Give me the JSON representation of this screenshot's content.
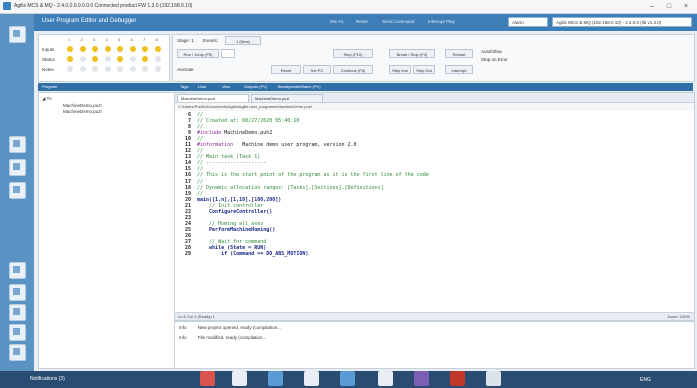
{
  "window": {
    "title": "Agilis MCS & MQ - 2.4.0.0.0.0.0.0.0 Connected product FW 1.3.0 (192.168.0.10)",
    "controls": [
      "–",
      "□",
      "×"
    ]
  },
  "header": {
    "title": "User Program Editor and Debugger",
    "menu": [
      "MS-A1",
      "Reset",
      "Send Command",
      "Interrupt Play"
    ],
    "dropdown_left": "Alarm",
    "dropdown_right": "Agilis MCS & MQ (192.168.0.10) - 2.4.0.0 (lib v1.3.0)"
  },
  "io_panel": {
    "labels": [
      "Inputs",
      "Status",
      "Notes"
    ],
    "columns": [
      "1",
      "2",
      "3",
      "4",
      "5",
      "6",
      "7",
      "8"
    ]
  },
  "controls": {
    "stage_label": "Stage: 1",
    "event_label": "Events:",
    "event_value": "1 (New)",
    "buttons": [
      "Run / Jump (F5)",
      "Step (F10)",
      "Break / Stop (F4)",
      "Reset",
      "Set PC",
      "Continue (F5)",
      "Step Into",
      "Step Out",
      "Restart",
      "Interrupt"
    ],
    "checkbox_1": "Animate",
    "checkbox_2": "Autofollow",
    "checkbox_3": "Stop on Error"
  },
  "tabstrip": [
    "Program",
    "Tags",
    "Lists",
    "Vars",
    "Outputs (PV)",
    "Breakpoints/Watch (PV)"
  ],
  "tree": {
    "root": "◢ Tv",
    "items": [
      "MachineDemo.puzl",
      "MachineDemo.puzl"
    ]
  },
  "editor": {
    "tabs": [
      "MachineDemo.puzl",
      "MachineDemo.puzl"
    ],
    "path": "C:\\Users\\Public\\Documents\\Agilis\\Agilis.user_programs\\MachineDemo.puzl",
    "lines": [
      {
        "n": "6",
        "parts": [
          {
            "c": "cm",
            "t": "//"
          }
        ]
      },
      {
        "n": "7",
        "parts": [
          {
            "c": "cm",
            "t": "// Created at: 08/27/2020 05:40:10"
          }
        ]
      },
      {
        "n": "8",
        "parts": [
          {
            "c": "cm",
            "t": "//"
          }
        ]
      },
      {
        "n": "9",
        "parts": [
          {
            "c": "kw",
            "t": "#include "
          },
          {
            "c": "tx",
            "t": "MachineDemo.puh2"
          }
        ]
      },
      {
        "n": "10",
        "parts": [
          {
            "c": "cm",
            "t": "//"
          }
        ]
      },
      {
        "n": "11",
        "parts": [
          {
            "c": "kw",
            "t": "#information"
          },
          {
            "c": "tx",
            "t": "   Machine demo user program, version 2.0"
          }
        ]
      },
      {
        "n": "12",
        "parts": [
          {
            "c": "cm",
            "t": "//"
          }
        ]
      },
      {
        "n": "13",
        "parts": [
          {
            "c": "cm",
            "t": "// Main task (Task 1)"
          }
        ]
      },
      {
        "n": "14",
        "parts": [
          {
            "c": "cm",
            "t": "// --------------------"
          }
        ]
      },
      {
        "n": "15",
        "parts": [
          {
            "c": "cm",
            "t": "//"
          }
        ]
      },
      {
        "n": "16",
        "parts": [
          {
            "c": "cm",
            "t": "// This is the start point of the program as it is the first line of the code"
          }
        ]
      },
      {
        "n": "17",
        "parts": [
          {
            "c": "cm",
            "t": "//"
          }
        ]
      },
      {
        "n": "18",
        "parts": [
          {
            "c": "cm",
            "t": "// Dynamic allocation ranges: [Tasks],[Sections],[Definitions]"
          }
        ]
      },
      {
        "n": "19",
        "parts": [
          {
            "c": "cm",
            "t": "//"
          }
        ]
      },
      {
        "n": "20",
        "parts": [
          {
            "c": "fn",
            "t": "main([1,n],[1,10],[100,200])"
          }
        ]
      },
      {
        "n": "21",
        "parts": [
          {
            "c": "cm",
            "t": "    // Init controller"
          }
        ]
      },
      {
        "n": "22",
        "parts": [
          {
            "c": "fn",
            "t": "    ConfigureController()"
          }
        ]
      },
      {
        "n": "23",
        "parts": [
          {
            "c": "tx",
            "t": ""
          }
        ]
      },
      {
        "n": "24",
        "parts": [
          {
            "c": "cm",
            "t": "    // Homing all axes"
          }
        ]
      },
      {
        "n": "25",
        "parts": [
          {
            "c": "fn",
            "t": "    PerformMachineHoming()"
          }
        ]
      },
      {
        "n": "26",
        "parts": [
          {
            "c": "tx",
            "t": ""
          }
        ]
      },
      {
        "n": "27",
        "parts": [
          {
            "c": "cm",
            "t": "    // Wait for command"
          }
        ]
      },
      {
        "n": "28",
        "parts": [
          {
            "c": "fn",
            "t": "    while (State = RUN)"
          }
        ]
      },
      {
        "n": "29",
        "parts": [
          {
            "c": "fn",
            "t": "        if (Command == DO_ABS_MOTION)"
          }
        ]
      }
    ],
    "status_left": "Ln 6 Col 1 (Ready) 1",
    "status_right": "Zoom: 100%"
  },
  "output": {
    "rows": [
      {
        "k": "Info",
        "v": "New project opened, ready (compilation..."
      },
      {
        "k": "Info",
        "v": "File modified, ready (compilation..."
      }
    ]
  },
  "statusbar": {
    "text": "Notifications (3)",
    "tray": "ENG"
  },
  "colors": {
    "sidebar": "#5a92c4",
    "header": "#3d7db8",
    "led_on": "#f0c020",
    "led_off": "#dfe5ea",
    "taskbar": "#2b4c72"
  }
}
